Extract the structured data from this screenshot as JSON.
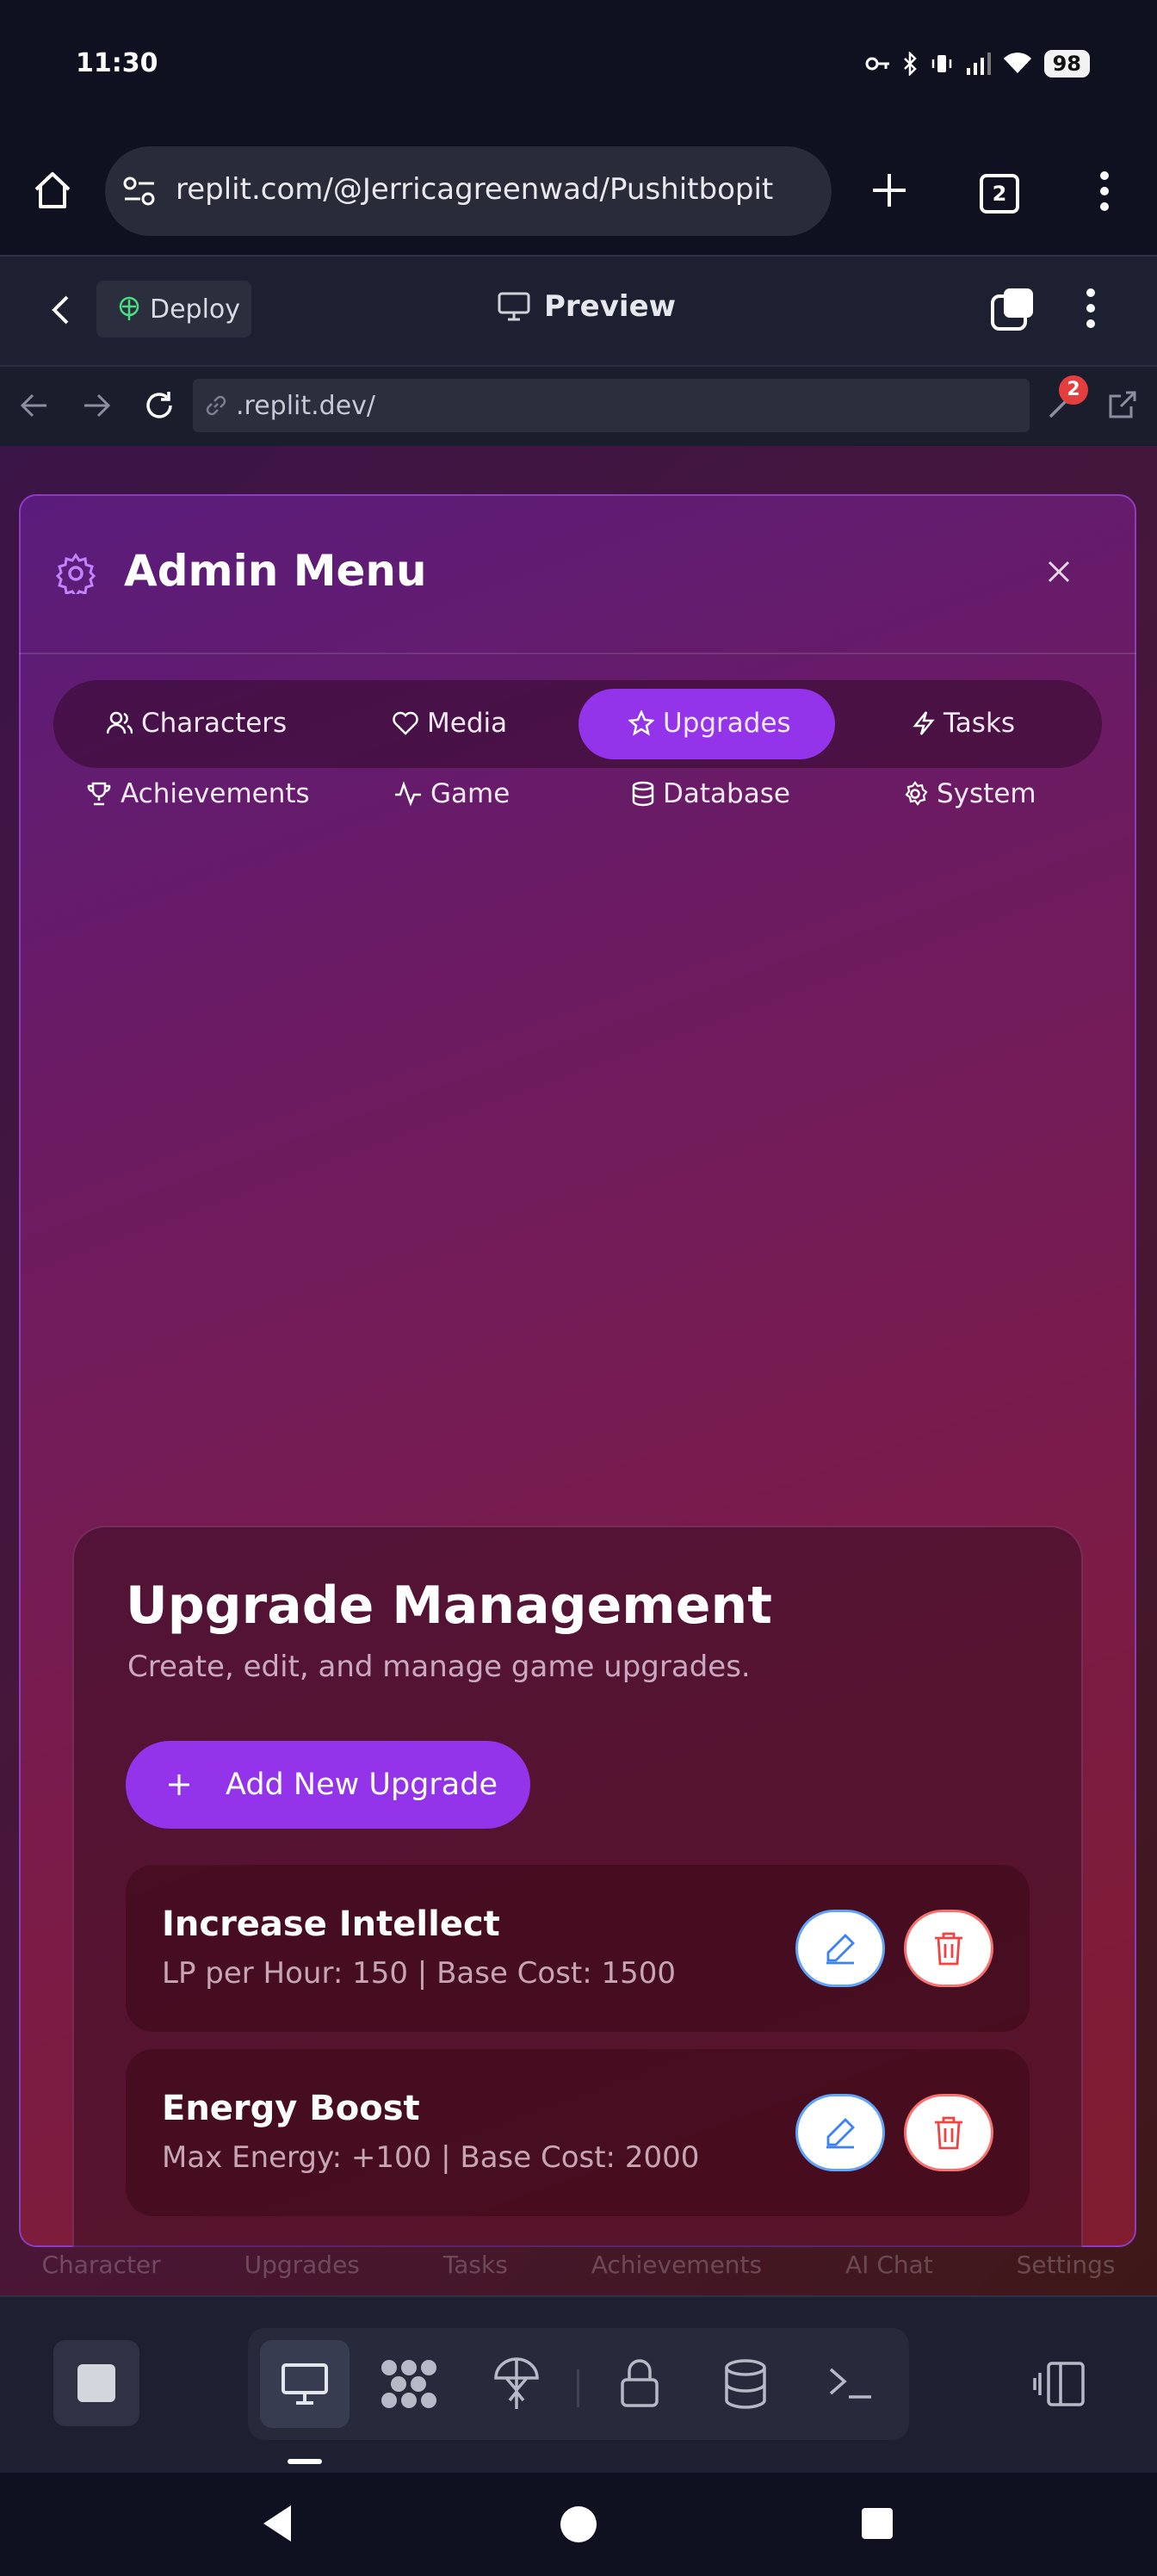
{
  "status_bar": {
    "time": "11:30",
    "battery": "98"
  },
  "browser": {
    "url": "replit.com/@Jerricagreenwad/Pushitbopit",
    "tab_count": "2"
  },
  "replit_header": {
    "deploy_label": "Deploy",
    "preview_label": "Preview"
  },
  "webview": {
    "url": ".replit.dev/",
    "notification_count": "2"
  },
  "background_app": {
    "nav": [
      "Character",
      "Upgrades",
      "Tasks",
      "Achievements",
      "AI Chat",
      "Settings"
    ]
  },
  "admin_menu": {
    "title": "Admin Menu",
    "tabs_row1": [
      "Characters",
      "Media",
      "Upgrades",
      "Tasks"
    ],
    "tabs_row2": [
      "Achievements",
      "Game",
      "Database",
      "System"
    ],
    "active_tab": "Upgrades"
  },
  "upgrade_management": {
    "title": "Upgrade Management",
    "subtitle": "Create, edit, and manage game upgrades.",
    "add_button": "Add New Upgrade",
    "upgrades": [
      {
        "name": "Increase Intellect",
        "meta": "LP per Hour: 150 | Base Cost: 1500"
      },
      {
        "name": "Energy Boost",
        "meta": "Max Energy: +100 | Base Cost: 2000"
      }
    ]
  },
  "colors": {
    "accent": "#9333ea",
    "edit": "#60a5fa",
    "delete": "#f87171"
  }
}
